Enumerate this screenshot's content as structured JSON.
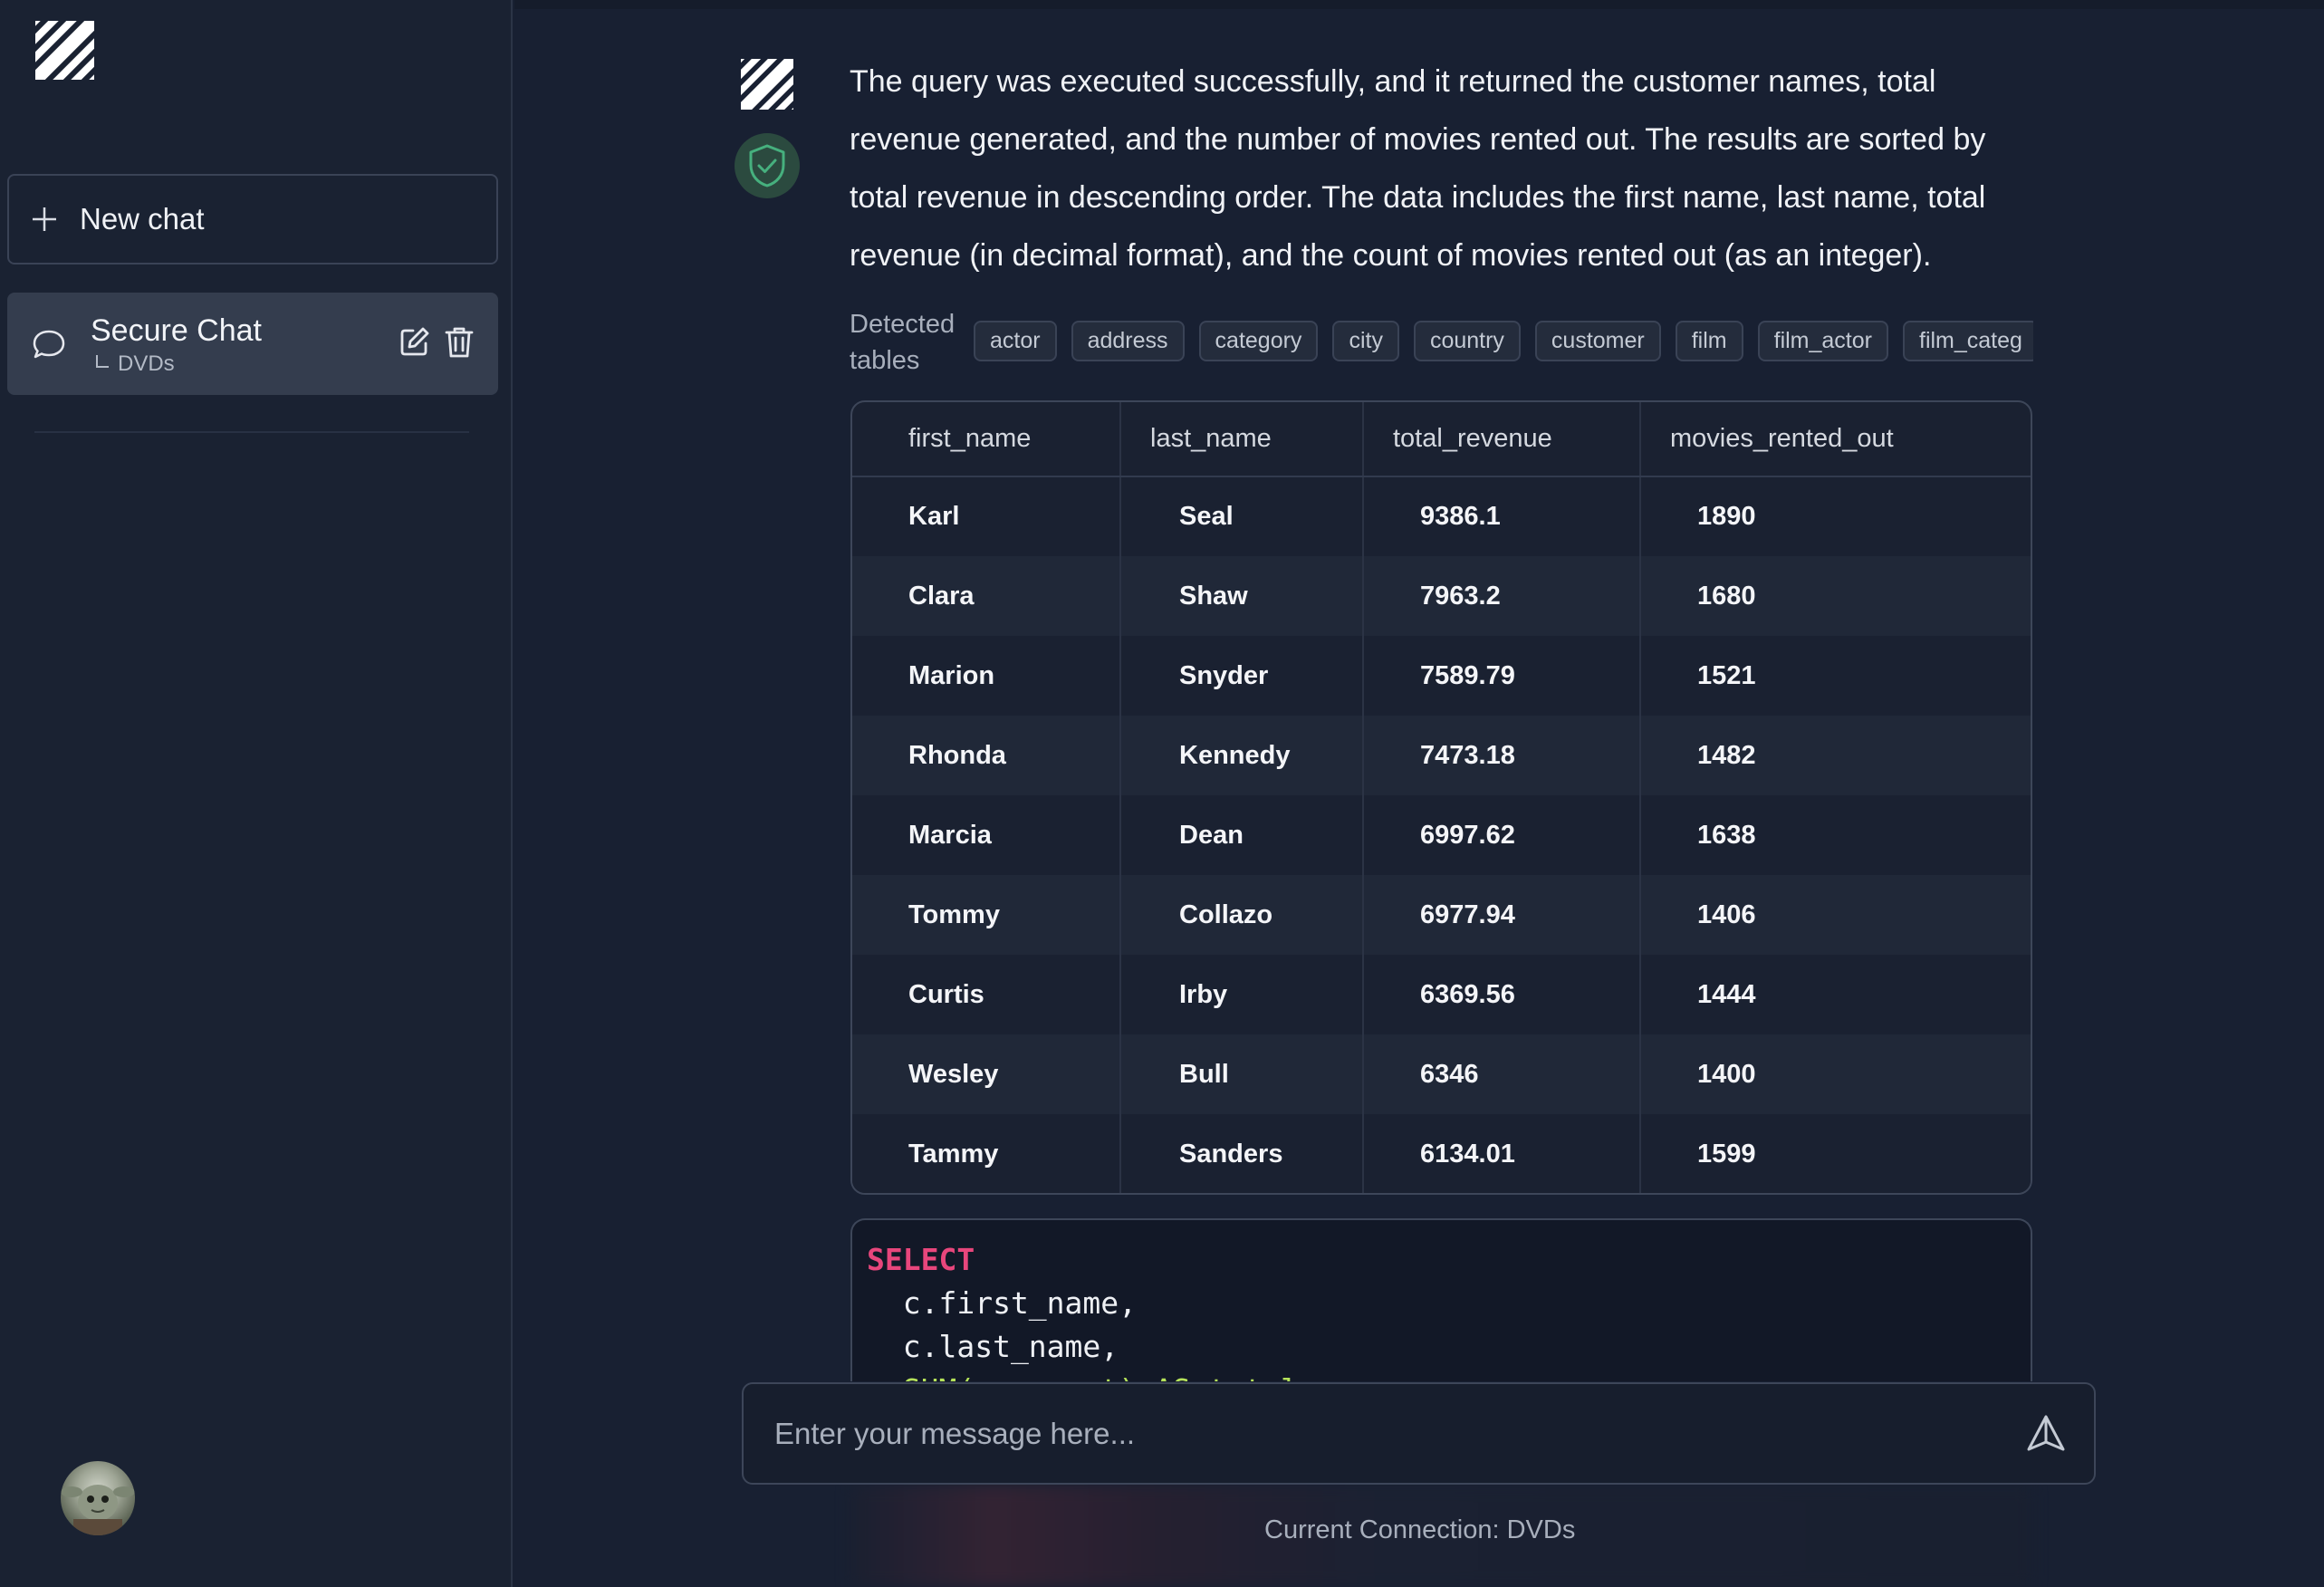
{
  "sidebar": {
    "new_chat_label": "New chat",
    "chats": [
      {
        "title": "Secure Chat",
        "connection": "DVDs"
      }
    ]
  },
  "message": {
    "text": "The query was executed successfully, and it returned the customer names, total revenue generated, and the number of movies rented out. The results are sorted by total revenue in descending order. The data includes the first name, last name, total revenue (in decimal format), and the count of movies rented out (as an integer).",
    "detected_label": "Detected tables",
    "detected_tables": [
      "actor",
      "address",
      "category",
      "city",
      "country",
      "customer",
      "film",
      "film_actor",
      "film_categ"
    ]
  },
  "results": {
    "columns": [
      "first_name",
      "last_name",
      "total_revenue",
      "movies_rented_out"
    ],
    "rows": [
      [
        "Karl",
        "Seal",
        "9386.1",
        "1890"
      ],
      [
        "Clara",
        "Shaw",
        "7963.2",
        "1680"
      ],
      [
        "Marion",
        "Snyder",
        "7589.79",
        "1521"
      ],
      [
        "Rhonda",
        "Kennedy",
        "7473.18",
        "1482"
      ],
      [
        "Marcia",
        "Dean",
        "6997.62",
        "1638"
      ],
      [
        "Tommy",
        "Collazo",
        "6977.94",
        "1406"
      ],
      [
        "Curtis",
        "Irby",
        "6369.56",
        "1444"
      ],
      [
        "Wesley",
        "Bull",
        "6346",
        "1400"
      ],
      [
        "Tammy",
        "Sanders",
        "6134.01",
        "1599"
      ]
    ]
  },
  "sql": {
    "keyword": "SELECT",
    "lines": [
      "  c.first_name,",
      "  c.last_name,",
      "  SUM(p.amount) AS total_revenue,"
    ]
  },
  "input": {
    "placeholder": "Enter your message here..."
  },
  "footer": {
    "connection_text": "Current Connection: DVDs"
  },
  "colors": {
    "background": "#182032",
    "sidebar": "#1a2232",
    "selected_chat": "#343d4e",
    "sql_keyword": "#e8467c",
    "shield": "#3fa776"
  },
  "icons": [
    "logo-icon",
    "plus-icon",
    "chat-bubble-icon",
    "edit-icon",
    "trash-icon",
    "shield-check-icon",
    "send-icon"
  ]
}
